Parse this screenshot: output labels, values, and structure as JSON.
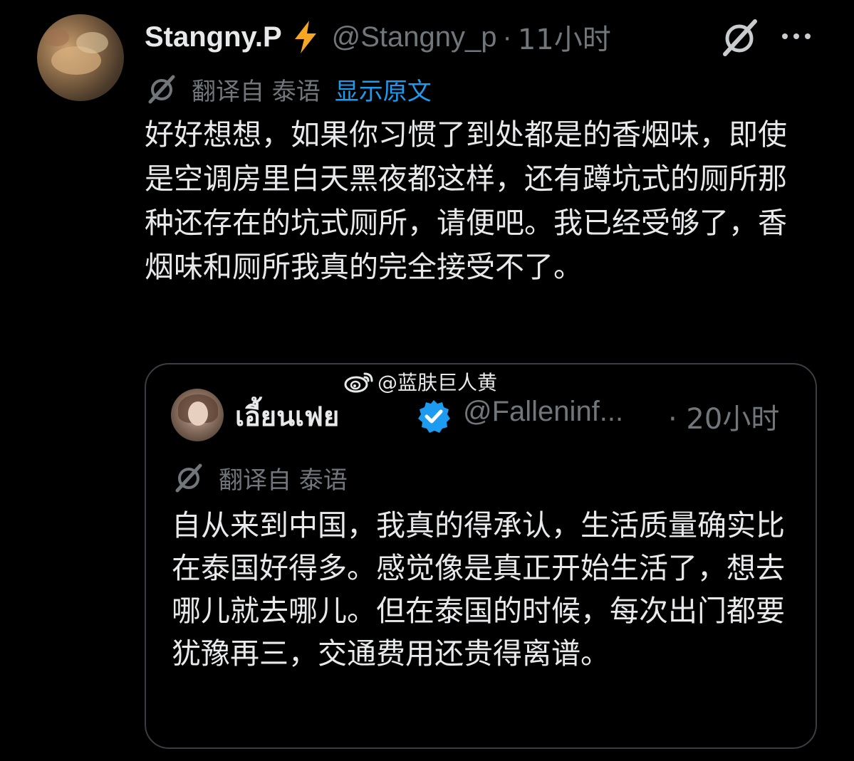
{
  "tweet": {
    "author_name": "Stangny.P",
    "badge_icon": "lightning-bolt-icon",
    "handle": "@Stangny_p",
    "separator": "·",
    "time": "11小时",
    "translated_from": "翻译自 泰语",
    "show_original": "显示原文",
    "text": "好好想想，如果你习惯了到处都是的香烟味，即使是空调房里白天黑夜都这样，还有蹲坑式的厕所那种还存在的坑式厕所，请便吧。我已经受够了，香烟味和厕所我真的完全接受不了。"
  },
  "watermark": {
    "icon": "weibo-icon",
    "text": "@蓝肤巨人黄"
  },
  "quoted_tweet": {
    "author_name": "เอี้ยนเฟย",
    "verified_icon": "verified-badge-icon",
    "handle": "@Falleninf...",
    "time": "· 20小时",
    "translated_from": "翻译自 泰语",
    "text": "自从来到中国，我真的得承认，生活质量确实比在泰国好得多。感觉像是真正开始生活了，想去哪儿就去哪儿。但在泰国的时候，每次出门都要犹豫再三，交通费用还贵得离谱。"
  },
  "colors": {
    "background": "#000000",
    "text": "#e7e9ea",
    "muted": "#71767b",
    "link": "#1d9bf0",
    "bolt": "#f5a623"
  }
}
